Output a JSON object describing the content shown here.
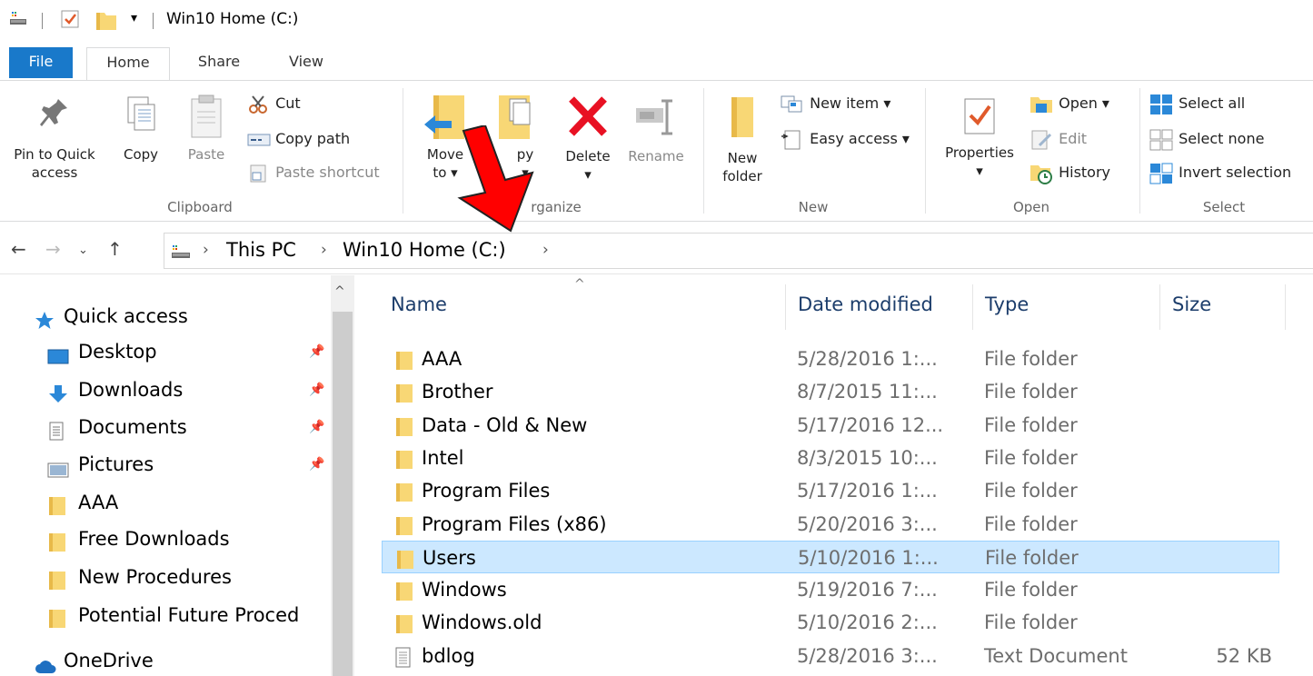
{
  "window": {
    "title": "Win10 Home (C:)"
  },
  "ribbon_tabs": {
    "file": "File",
    "home": "Home",
    "share": "Share",
    "view": "View"
  },
  "clipboard": {
    "pin_line1": "Pin to Quick",
    "pin_line2": "access",
    "copy": "Copy",
    "paste": "Paste",
    "cut": "Cut",
    "copy_path": "Copy path",
    "paste_shortcut": "Paste shortcut",
    "group": "Clipboard"
  },
  "organize": {
    "move_line1": "Move",
    "move_line2": "to ▾",
    "copy_to_line1": "py",
    "delete": "Delete",
    "rename": "Rename",
    "group": "Organize",
    "group_visible": "rganize"
  },
  "new": {
    "new_folder_line1": "New",
    "new_folder_line2": "folder",
    "new_item": "New item ▾",
    "easy_access": "Easy access ▾",
    "group": "New"
  },
  "open": {
    "properties": "Properties",
    "open": "Open ▾",
    "edit": "Edit",
    "history": "History",
    "group": "Open"
  },
  "select": {
    "select_all": "Select all",
    "select_none": "Select none",
    "invert_selection": "Invert selection",
    "group": "Select"
  },
  "address": {
    "crumbs": [
      "This PC",
      "Win10 Home (C:)"
    ]
  },
  "navpane": {
    "items": [
      {
        "label": "Quick access",
        "icon": "star-icon",
        "pinned": false
      },
      {
        "label": "Desktop",
        "icon": "desktop-icon",
        "pinned": true
      },
      {
        "label": "Downloads",
        "icon": "download-icon",
        "pinned": true
      },
      {
        "label": "Documents",
        "icon": "document-icon",
        "pinned": true
      },
      {
        "label": "Pictures",
        "icon": "pictures-icon",
        "pinned": true
      },
      {
        "label": "AAA",
        "icon": "folder-icon",
        "pinned": false
      },
      {
        "label": "Free Downloads",
        "icon": "folder-icon",
        "pinned": false
      },
      {
        "label": "New Procedures",
        "icon": "folder-icon",
        "pinned": false
      },
      {
        "label": "Potential Future Proced",
        "icon": "folder-icon",
        "pinned": false
      },
      {
        "label": "OneDrive",
        "icon": "cloud-icon",
        "pinned": false
      }
    ]
  },
  "filelist": {
    "columns": {
      "name": "Name",
      "date": "Date modified",
      "type": "Type",
      "size": "Size"
    },
    "rows": [
      {
        "name": "AAA",
        "date": "5/28/2016 1:...",
        "type": "File folder",
        "size": "",
        "icon": "folder-icon"
      },
      {
        "name": "Brother",
        "date": "8/7/2015 11:...",
        "type": "File folder",
        "size": "",
        "icon": "folder-icon"
      },
      {
        "name": "Data - Old & New",
        "date": "5/17/2016 12...",
        "type": "File folder",
        "size": "",
        "icon": "folder-icon"
      },
      {
        "name": "Intel",
        "date": "8/3/2015 10:...",
        "type": "File folder",
        "size": "",
        "icon": "folder-icon"
      },
      {
        "name": "Program Files",
        "date": "5/17/2016 1:...",
        "type": "File folder",
        "size": "",
        "icon": "folder-icon"
      },
      {
        "name": "Program Files (x86)",
        "date": "5/20/2016 3:...",
        "type": "File folder",
        "size": "",
        "icon": "folder-icon"
      },
      {
        "name": "Users",
        "date": "5/10/2016 1:...",
        "type": "File folder",
        "size": "",
        "icon": "folder-icon",
        "selected": true
      },
      {
        "name": "Windows",
        "date": "5/19/2016 7:...",
        "type": "File folder",
        "size": "",
        "icon": "folder-icon"
      },
      {
        "name": "Windows.old",
        "date": "5/10/2016 2:...",
        "type": "File folder",
        "size": "",
        "icon": "folder-icon"
      },
      {
        "name": "bdlog",
        "date": "5/28/2016 3:...",
        "type": "Text Document",
        "size": "52 KB",
        "icon": "text-file-icon"
      }
    ]
  },
  "colors": {
    "accent": "#1979ca",
    "selection": "#cce8ff",
    "folder": "#f8d775",
    "annotation": "#ff0000"
  }
}
